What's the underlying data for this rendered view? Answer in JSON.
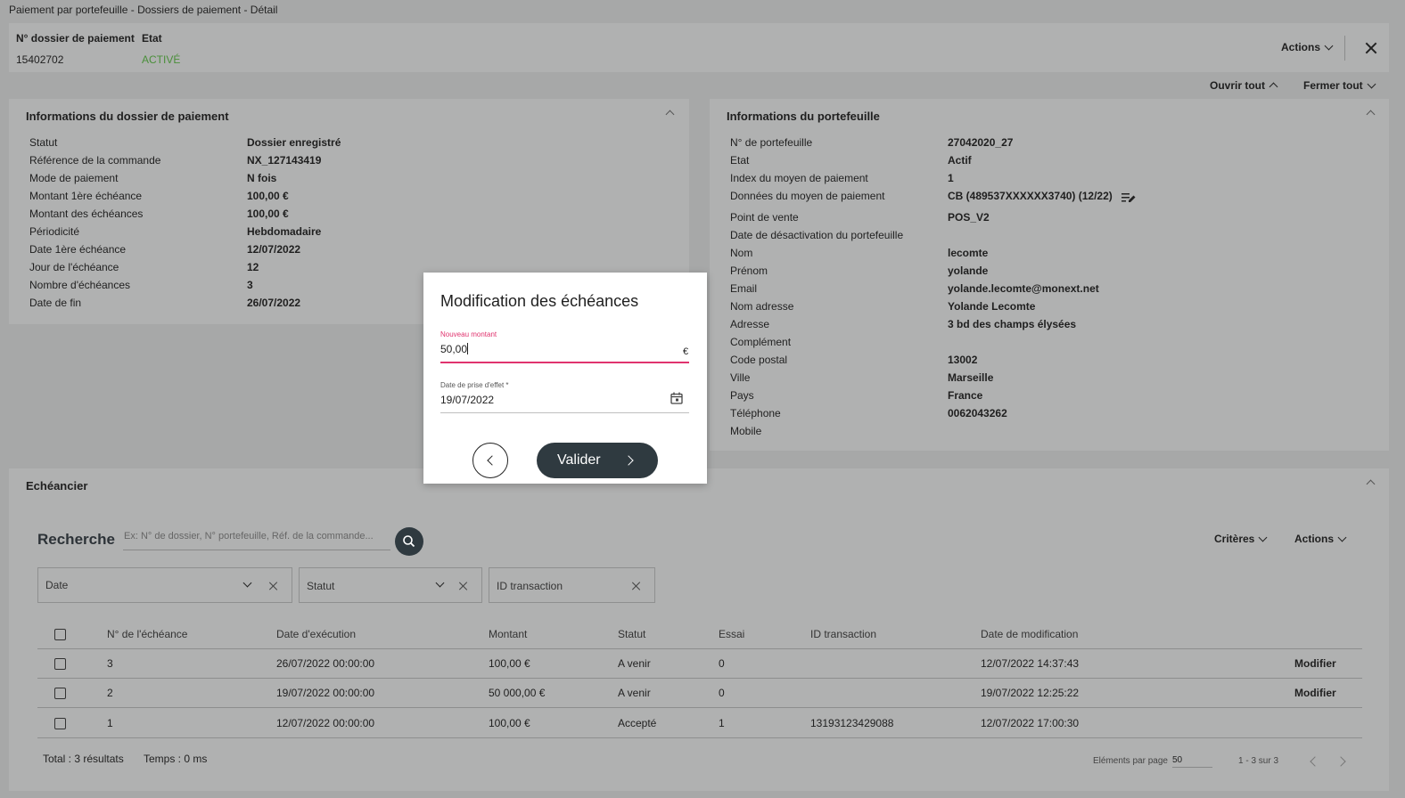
{
  "page_title": "Paiement par portefeuille - Dossiers de paiement - Détail",
  "header": {
    "dossier_label": "N° dossier de paiement",
    "dossier_value": "15402702",
    "etat_label": "Etat",
    "etat_value": "ACTIVÉ",
    "actions_label": "Actions"
  },
  "toggles": {
    "open_all": "Ouvrir tout",
    "close_all": "Fermer tout"
  },
  "dossier_info": {
    "title": "Informations du dossier de paiement",
    "rows": [
      {
        "label": "Statut",
        "value": "Dossier enregistré"
      },
      {
        "label": "Référence de la commande",
        "value": "NX_127143419"
      },
      {
        "label": "Mode de paiement",
        "value": "N fois"
      },
      {
        "label": "Montant 1ère échéance",
        "value": "100,00 €"
      },
      {
        "label": "Montant des échéances",
        "value": "100,00 €"
      },
      {
        "label": "Périodicité",
        "value": "Hebdomadaire"
      },
      {
        "label": "Date 1ère échéance",
        "value": "12/07/2022"
      },
      {
        "label": "Jour de l'échéance",
        "value": "12"
      },
      {
        "label": "Nombre d'échéances",
        "value": "3"
      },
      {
        "label": "Date de fin",
        "value": "26/07/2022"
      }
    ]
  },
  "wallet_info": {
    "title": "Informations du portefeuille",
    "rows": [
      {
        "label": "N° de portefeuille",
        "value": "27042020_27"
      },
      {
        "label": "Etat",
        "value": "Actif"
      },
      {
        "label": "Index du moyen de paiement",
        "value": "1"
      },
      {
        "label": "Données du moyen de paiement",
        "value": "CB (489537XXXXXX3740) (12/22)"
      },
      {
        "label": "Point de vente",
        "value": "POS_V2"
      },
      {
        "label": "Date de désactivation du portefeuille",
        "value": ""
      },
      {
        "label": "Nom",
        "value": "lecomte"
      },
      {
        "label": "Prénom",
        "value": "yolande"
      },
      {
        "label": "Email",
        "value": "yolande.lecomte@monext.net"
      },
      {
        "label": "Nom adresse",
        "value": "Yolande Lecomte"
      },
      {
        "label": "Adresse",
        "value": "3 bd des champs élysées"
      },
      {
        "label": "Complément",
        "value": ""
      },
      {
        "label": "Code postal",
        "value": "13002"
      },
      {
        "label": "Ville",
        "value": "Marseille"
      },
      {
        "label": "Pays",
        "value": "France"
      },
      {
        "label": "Téléphone",
        "value": "0062043262"
      },
      {
        "label": "Mobile",
        "value": ""
      }
    ]
  },
  "schedule": {
    "title": "Echéancier",
    "search_title": "Recherche",
    "search_placeholder": "Ex: N° de dossier, N° portefeuille, Réf. de la commande...",
    "criteria_label": "Critères",
    "actions_label": "Actions",
    "filters": {
      "date": "Date",
      "statut": "Statut",
      "id_transaction": "ID transaction"
    },
    "columns": [
      "N° de l'échéance",
      "Date d'exécution",
      "Montant",
      "Statut",
      "Essai",
      "ID transaction",
      "Date de modification"
    ],
    "rows": [
      {
        "num": "3",
        "exec": "26/07/2022 00:00:00",
        "montant": "100,00 €",
        "statut": "A venir",
        "essai": "0",
        "idtx": "",
        "modif": "12/07/2022 14:37:43",
        "action": "Modifier"
      },
      {
        "num": "2",
        "exec": "19/07/2022 00:00:00",
        "montant": "50 000,00 €",
        "statut": "A venir",
        "essai": "0",
        "idtx": "",
        "modif": "19/07/2022 12:25:22",
        "action": "Modifier"
      },
      {
        "num": "1",
        "exec": "12/07/2022 00:00:00",
        "montant": "100,00 €",
        "statut": "Accepté",
        "essai": "1",
        "idtx": "13193123429088",
        "modif": "12/07/2022 17:00:30",
        "action": ""
      }
    ],
    "total": "Total : 3 résultats",
    "temps": "Temps : 0 ms",
    "per_page_label": "Eléments par page",
    "per_page_value": "50",
    "range": "1 - 3 sur 3"
  },
  "modal": {
    "title": "Modification des échéances",
    "amount_label": "Nouveau montant",
    "amount_value": "50,00",
    "currency": "€",
    "date_label": "Date de prise d'effet *",
    "date_value": "19/07/2022",
    "submit_label": "Valider"
  },
  "colors": {
    "accent_pink": "#e0336e",
    "dark_button": "#2f3a40",
    "status_green": "#4a8f3a"
  }
}
